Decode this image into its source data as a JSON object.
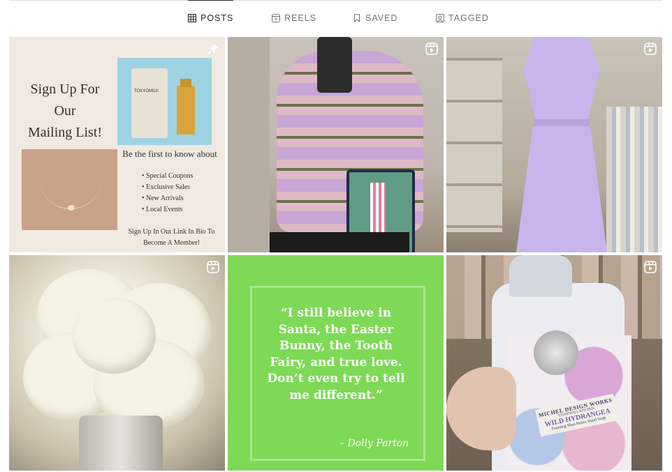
{
  "tabs": [
    {
      "label": "POSTS",
      "icon": "grid-icon",
      "active": true
    },
    {
      "label": "REELS",
      "icon": "reels-icon",
      "active": false
    },
    {
      "label": "SAVED",
      "icon": "bookmark-icon",
      "active": false
    },
    {
      "label": "TAGGED",
      "icon": "tagged-icon",
      "active": false
    }
  ],
  "posts": [
    {
      "badge": "pin-icon",
      "heading_line1": "Sign Up For Our",
      "heading_line2": "Mailing List!",
      "product_label": "TOKYOMILK",
      "subheading": "Be the first to know about",
      "bullets": [
        "Special Coupons",
        "Exclusive Sales",
        "New Arrivals",
        "Local Events"
      ],
      "footer_line1": "Sign Up In Our Link In Bio To",
      "footer_line2": "Become A Member!"
    },
    {
      "badge": "reel-icon"
    },
    {
      "badge": "reel-icon"
    },
    {
      "badge": "reel-icon"
    },
    {
      "quote_lines": [
        "“I still believe in",
        "Santa, the Easter",
        "Bunny, the Tooth",
        "Fairy, and true love.",
        "Don’t even try to tell",
        "me different.”"
      ],
      "signature": "– Dolly Parton"
    },
    {
      "badge": "reel-icon",
      "label_brand": "MICHEL DESIGN WORKS",
      "label_sub": "STONEWALL KITCHEN",
      "label_name": "WILD HYDRANGEA",
      "label_desc": "Foaming Shea Butter Hand Soap"
    }
  ],
  "colors": {
    "quote_bg": "#7ed957",
    "active_tab": "#262626",
    "inactive_tab": "#737373"
  }
}
